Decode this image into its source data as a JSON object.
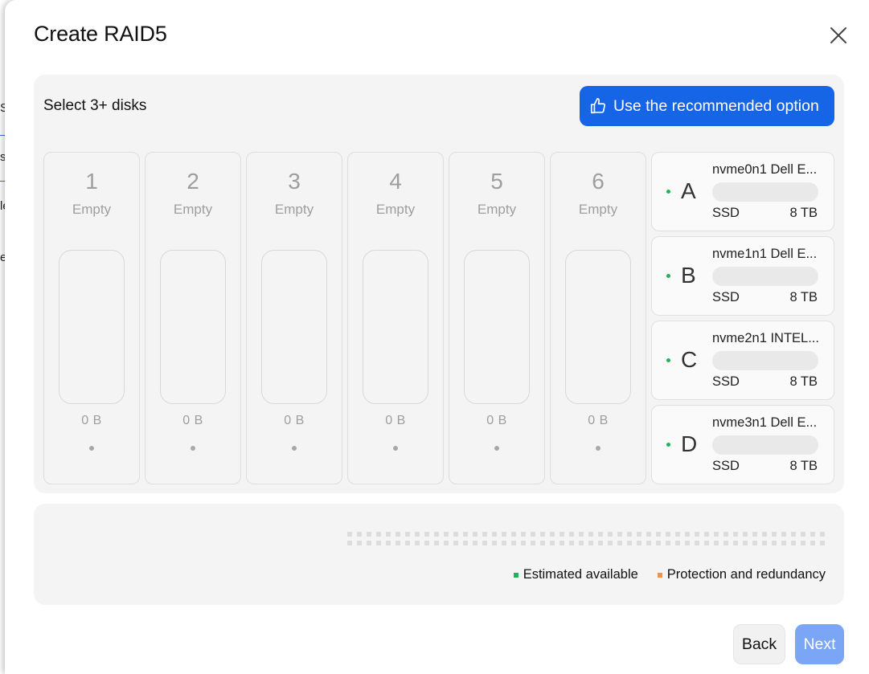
{
  "background": {
    "fragments": [
      "Sc",
      "st",
      "le",
      "el"
    ]
  },
  "dialog": {
    "title": "Create RAID5",
    "close_icon": "close-icon"
  },
  "selection": {
    "label": "Select 3+ disks",
    "recommend_button": "Use the recommended option",
    "recommend_icon": "thumbs-up-icon",
    "accent_color": "#1565e6"
  },
  "slots": [
    {
      "number": "1",
      "state": "Empty",
      "size": "0 B"
    },
    {
      "number": "2",
      "state": "Empty",
      "size": "0 B"
    },
    {
      "number": "3",
      "state": "Empty",
      "size": "0 B"
    },
    {
      "number": "4",
      "state": "Empty",
      "size": "0 B"
    },
    {
      "number": "5",
      "state": "Empty",
      "size": "0 B"
    },
    {
      "number": "6",
      "state": "Empty",
      "size": "0 B"
    }
  ],
  "disks": [
    {
      "letter": "A",
      "name": "nvme0n1 Dell E...",
      "type": "SSD",
      "capacity": "8 TB"
    },
    {
      "letter": "B",
      "name": "nvme1n1 Dell E...",
      "type": "SSD",
      "capacity": "8 TB"
    },
    {
      "letter": "C",
      "name": "nvme2n1 INTEL...",
      "type": "SSD",
      "capacity": "8 TB"
    },
    {
      "letter": "D",
      "name": "nvme3n1 Dell E...",
      "type": "SSD",
      "capacity": "8 TB"
    }
  ],
  "capacity": {
    "legend": [
      {
        "label": "Estimated available",
        "color": "#22b35a"
      },
      {
        "label": "Protection and redundancy",
        "color": "#f0934a"
      }
    ]
  },
  "footer": {
    "back_label": "Back",
    "next_label": "Next"
  }
}
